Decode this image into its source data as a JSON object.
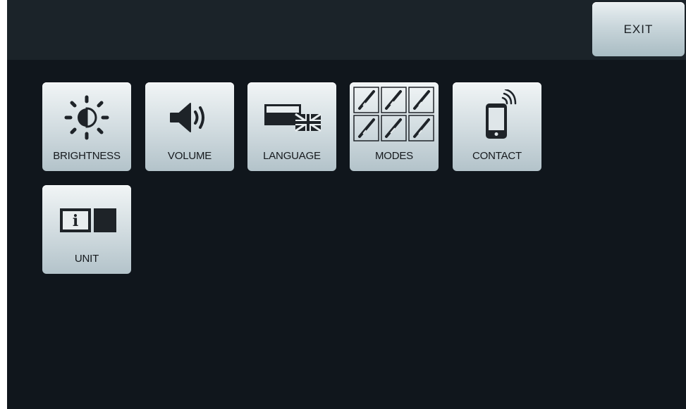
{
  "header": {
    "exit_label": "EXIT"
  },
  "menu": {
    "tiles": [
      {
        "label": "BRIGHTNESS",
        "icon": "brightness-icon"
      },
      {
        "label": "VOLUME",
        "icon": "speaker-icon"
      },
      {
        "label": "LANGUAGE",
        "icon": "flag-icon"
      },
      {
        "label": "MODES",
        "icon": "instruments-icon"
      },
      {
        "label": "CONTACT",
        "icon": "phone-icon"
      },
      {
        "label": "UNIT",
        "icon": "info-icon"
      }
    ]
  },
  "colors": {
    "background": "#10161c",
    "topbar": "#1b2329",
    "tile_top": "#f1f5f6",
    "tile_bottom": "#b3c3ca",
    "icon": "#1e2328"
  }
}
